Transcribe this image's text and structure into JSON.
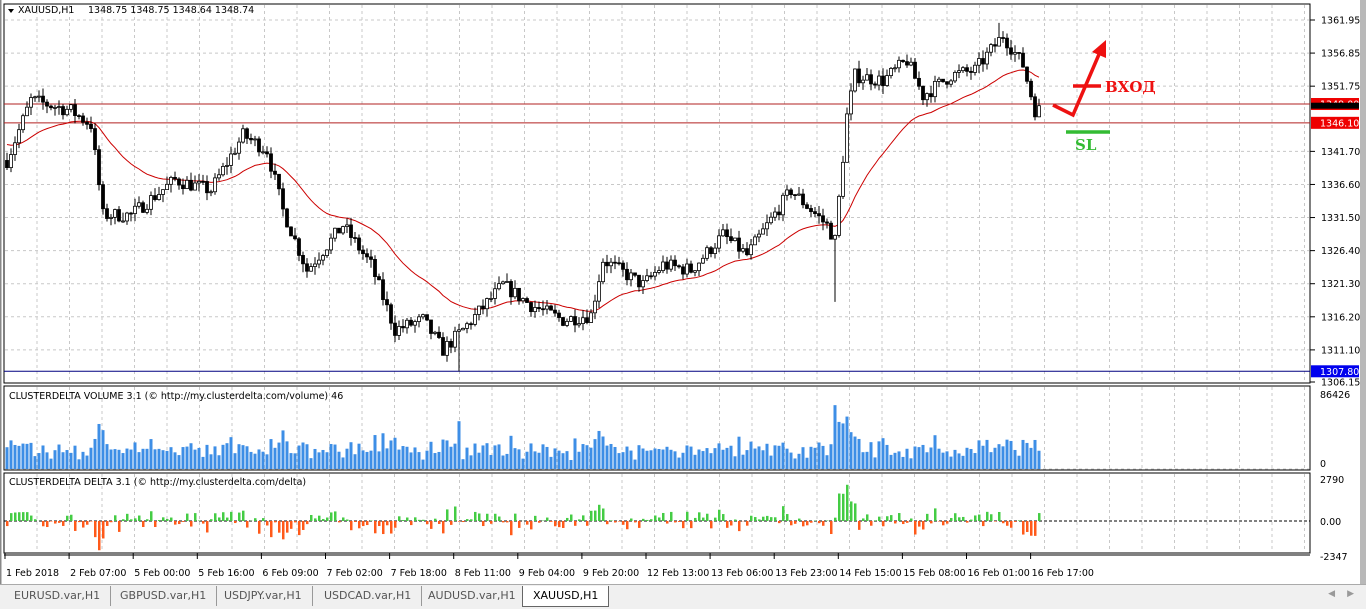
{
  "window": {
    "title": "XAUUSD,H1",
    "ohlc": "1348.75 1348.75 1348.64 1348.74"
  },
  "tabs": [
    {
      "label": "EURUSD.var,H1",
      "active": false
    },
    {
      "label": "GBPUSD.var,H1",
      "active": false
    },
    {
      "label": "USDJPY.var,H1",
      "active": false
    },
    {
      "label": "USDCAD.var,H1",
      "active": false
    },
    {
      "label": "AUDUSD.var,H1",
      "active": false
    },
    {
      "label": "XAUUSD,H1",
      "active": true
    }
  ],
  "scroll_icons": [
    "scroll-left-icon",
    "scroll-right-icon"
  ],
  "colors": {
    "ma": "#cc0000",
    "level": "#b22222",
    "blue_level": "#000080",
    "volume": "#3d8ee6",
    "delta_up": "#44cc44",
    "delta_down": "#ff5a1a",
    "annotation_red": "#ee1111",
    "annotation_green": "#33bb33"
  },
  "chart_data": {
    "type": "candlestick",
    "symbol": "XAUUSD",
    "timeframe": "H1",
    "price_axis": {
      "ticks": [
        "1361.95",
        "1356.85",
        "1351.75",
        "1341.70",
        "1336.60",
        "1331.50",
        "1326.40",
        "1321.30",
        "1316.20",
        "1311.10",
        "1306.15"
      ],
      "range": [
        1306.15,
        1361.95
      ]
    },
    "time_axis": {
      "ticks": [
        "1 Feb 2018",
        "2 Feb 07:00",
        "5 Feb 00:00",
        "5 Feb 16:00",
        "6 Feb 09:00",
        "7 Feb 02:00",
        "7 Feb 18:00",
        "8 Feb 11:00",
        "9 Feb 04:00",
        "9 Feb 20:00",
        "12 Feb 13:00",
        "13 Feb 06:00",
        "13 Feb 23:00",
        "14 Feb 15:00",
        "15 Feb 08:00",
        "16 Feb 01:00",
        "16 Feb 17:00"
      ]
    },
    "bar_count": 259,
    "close_path": [
      [
        0,
        1340.3
      ],
      [
        6,
        1349.6
      ],
      [
        16,
        1348
      ],
      [
        21,
        1345.8
      ],
      [
        24,
        1331.9
      ],
      [
        31,
        1331.9
      ],
      [
        42,
        1337.3
      ],
      [
        51,
        1335.7
      ],
      [
        59,
        1344.2
      ],
      [
        65,
        1341.9
      ],
      [
        69,
        1332.6
      ],
      [
        75,
        1323.4
      ],
      [
        84,
        1330.3
      ],
      [
        91,
        1324.2
      ],
      [
        97,
        1314.2
      ],
      [
        104,
        1315.7
      ],
      [
        109,
        1311.1
      ],
      [
        114,
        1314.2
      ],
      [
        124,
        1321.1
      ],
      [
        131,
        1318
      ],
      [
        139,
        1315.7
      ],
      [
        146,
        1316.5
      ],
      [
        149,
        1325
      ],
      [
        159,
        1321.1
      ],
      [
        164,
        1324.2
      ],
      [
        171,
        1323.4
      ],
      [
        179,
        1328.8
      ],
      [
        185,
        1325.7
      ],
      [
        196,
        1335.7
      ],
      [
        205,
        1330.3
      ],
      [
        207,
        1328
      ],
      [
        210,
        1347.2
      ],
      [
        212,
        1353.4
      ],
      [
        219,
        1352.6
      ],
      [
        225,
        1355.7
      ],
      [
        229,
        1350.3
      ],
      [
        236,
        1353.4
      ],
      [
        242,
        1354.2
      ],
      [
        249,
        1359.6
      ],
      [
        254,
        1355
      ],
      [
        257,
        1348.1
      ],
      [
        258,
        1348.74
      ]
    ],
    "extremes": [
      [
        207,
        1318.5
      ],
      [
        113,
        1307.8
      ],
      [
        248,
        1361.5
      ]
    ],
    "levels": [
      {
        "price": "1349.00",
        "color": "red"
      },
      {
        "price": "1346.10",
        "color": "red"
      },
      {
        "price": "1307.80",
        "color": "blue"
      }
    ],
    "current_price": "1348.74",
    "indicators": [
      {
        "name": "CLUSTERDELTA VOLUME 3.1 (© http://my.clusterdelta.com/volume) 46",
        "max": "86426",
        "min": "0"
      },
      {
        "name": "CLUSTERDELTA DELTA 3.1 (© http://my.clusterdelta.com/delta)",
        "max": "2790",
        "zero": "0.00",
        "min": "-2347"
      }
    ],
    "annotations": {
      "entry": "ВХОД",
      "stop": "SL"
    }
  }
}
